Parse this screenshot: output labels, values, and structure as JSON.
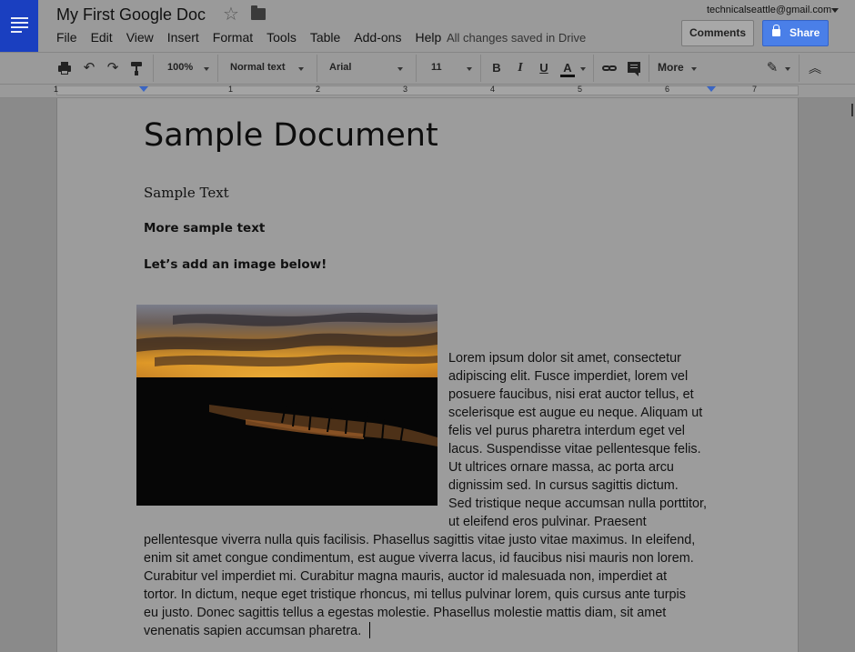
{
  "app": {
    "doc_title": "My First Google Doc",
    "menu": [
      "File",
      "Edit",
      "View",
      "Insert",
      "Format",
      "Tools",
      "Table",
      "Add-ons",
      "Help"
    ],
    "save_status": "All changes saved in Drive",
    "account_email": "technicalseattle@gmail.com",
    "comments_label": "Comments",
    "share_label": "Share"
  },
  "toolbar": {
    "zoom": "100%",
    "style": "Normal text",
    "font": "Arial",
    "size": "11",
    "bold": "B",
    "italic": "I",
    "underline": "U",
    "text_color": "A",
    "more_label": "More"
  },
  "ruler": {
    "numbers": [
      "1",
      "1",
      "2",
      "3",
      "4",
      "5",
      "6",
      "7"
    ]
  },
  "document": {
    "heading": "Sample Document",
    "subtitle": "Sample Text",
    "line2": "More sample text",
    "line3": "Let’s add an image below!",
    "wrap_lines": [
      "Lorem ipsum dolor sit amet, consectetur",
      "adipiscing elit. Fusce imperdiet, lorem vel",
      "posuere faucibus, nisi erat auctor tellus, et",
      "scelerisque est augue eu neque. Aliquam ut",
      "felis vel purus pharetra interdum eget vel",
      "lacus. Suspendisse vitae pellentesque felis.",
      "Ut ultrices ornare massa, ac porta arcu",
      "dignissim sed. In cursus sagittis dictum.",
      "Sed tristique neque accumsan nulla porttitor,",
      "ut eleifend eros pulvinar. Praesent"
    ],
    "body_lines": [
      "pellentesque viverra nulla quis facilisis. Phasellus sagittis vitae justo vitae maximus. In eleifend,",
      "enim sit amet congue condimentum, est augue viverra lacus, id faucibus nisi mauris non lorem.",
      "Curabitur vel imperdiet mi. Curabitur magna mauris, auctor id malesuada non, imperdiet at",
      "tortor. In dictum, neque eget tristique rhoncus, mi tellus pulvinar lorem, quis cursus ante turpis",
      "eu justo. Donec sagittis tellus a egestas molestie. Phasellus molestie mattis diam, sit amet",
      "venenatis sapien accumsan pharetra."
    ]
  },
  "colors": {
    "docs_blue": "#1a3fc0",
    "share_blue": "#4a7fe8",
    "overlay_gray": "#9a9a9a"
  }
}
